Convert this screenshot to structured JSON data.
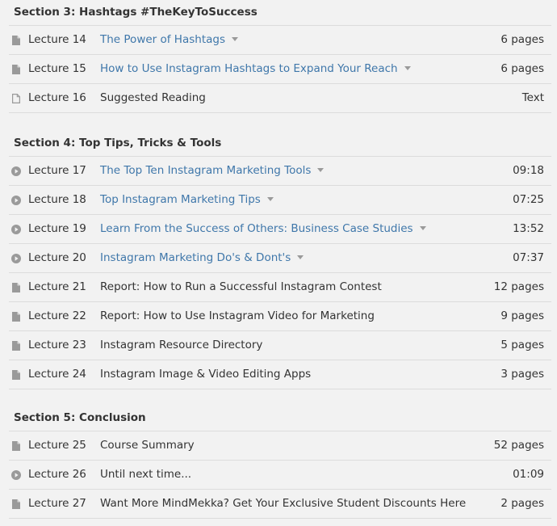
{
  "sections": [
    {
      "title": "Section 3: Hashtags #TheKeyToSuccess",
      "lectures": [
        {
          "number": "Lecture 14",
          "title": "The Power of Hashtags",
          "meta": "6 pages",
          "icon": "document-icon",
          "expandable": true
        },
        {
          "number": "Lecture 15",
          "title": "How to Use Instagram Hashtags to Expand Your Reach",
          "meta": "6 pages",
          "icon": "document-icon",
          "expandable": true
        },
        {
          "number": "Lecture 16",
          "title": "Suggested Reading",
          "meta": "Text",
          "icon": "text-document-icon",
          "expandable": false
        }
      ]
    },
    {
      "title": "Section 4: Top Tips, Tricks & Tools",
      "lectures": [
        {
          "number": "Lecture 17",
          "title": "The Top Ten Instagram Marketing Tools",
          "meta": "09:18",
          "icon": "play-icon",
          "expandable": true
        },
        {
          "number": "Lecture 18",
          "title": "Top Instagram Marketing Tips",
          "meta": "07:25",
          "icon": "play-icon",
          "expandable": true
        },
        {
          "number": "Lecture 19",
          "title": "Learn From the Success of Others: Business Case Studies",
          "meta": "13:52",
          "icon": "play-icon",
          "expandable": true
        },
        {
          "number": "Lecture 20",
          "title": "Instagram Marketing Do's & Dont's",
          "meta": "07:37",
          "icon": "play-icon",
          "expandable": true
        },
        {
          "number": "Lecture 21",
          "title": "Report: How to Run a Successful Instagram Contest",
          "meta": "12 pages",
          "icon": "document-icon",
          "expandable": false
        },
        {
          "number": "Lecture 22",
          "title": "Report: How to Use Instagram Video for Marketing",
          "meta": "9 pages",
          "icon": "document-icon",
          "expandable": false
        },
        {
          "number": "Lecture 23",
          "title": "Instagram Resource Directory",
          "meta": "5 pages",
          "icon": "document-icon",
          "expandable": false
        },
        {
          "number": "Lecture 24",
          "title": "Instagram Image & Video Editing Apps",
          "meta": "3 pages",
          "icon": "document-icon",
          "expandable": false
        }
      ]
    },
    {
      "title": "Section 5: Conclusion",
      "lectures": [
        {
          "number": "Lecture 25",
          "title": "Course Summary",
          "meta": "52 pages",
          "icon": "document-icon",
          "expandable": false
        },
        {
          "number": "Lecture 26",
          "title": "Until next time...",
          "meta": "01:09",
          "icon": "play-icon",
          "expandable": false
        },
        {
          "number": "Lecture 27",
          "title": "Want More MindMekka? Get Your Exclusive Student Discounts Here",
          "meta": "2 pages",
          "icon": "document-icon",
          "expandable": false
        }
      ]
    }
  ],
  "colors": {
    "link": "#3f77aa",
    "text": "#333333",
    "icon": "#9a9a9a",
    "divider": "#dcdcdc",
    "background": "#f2f2f2"
  }
}
